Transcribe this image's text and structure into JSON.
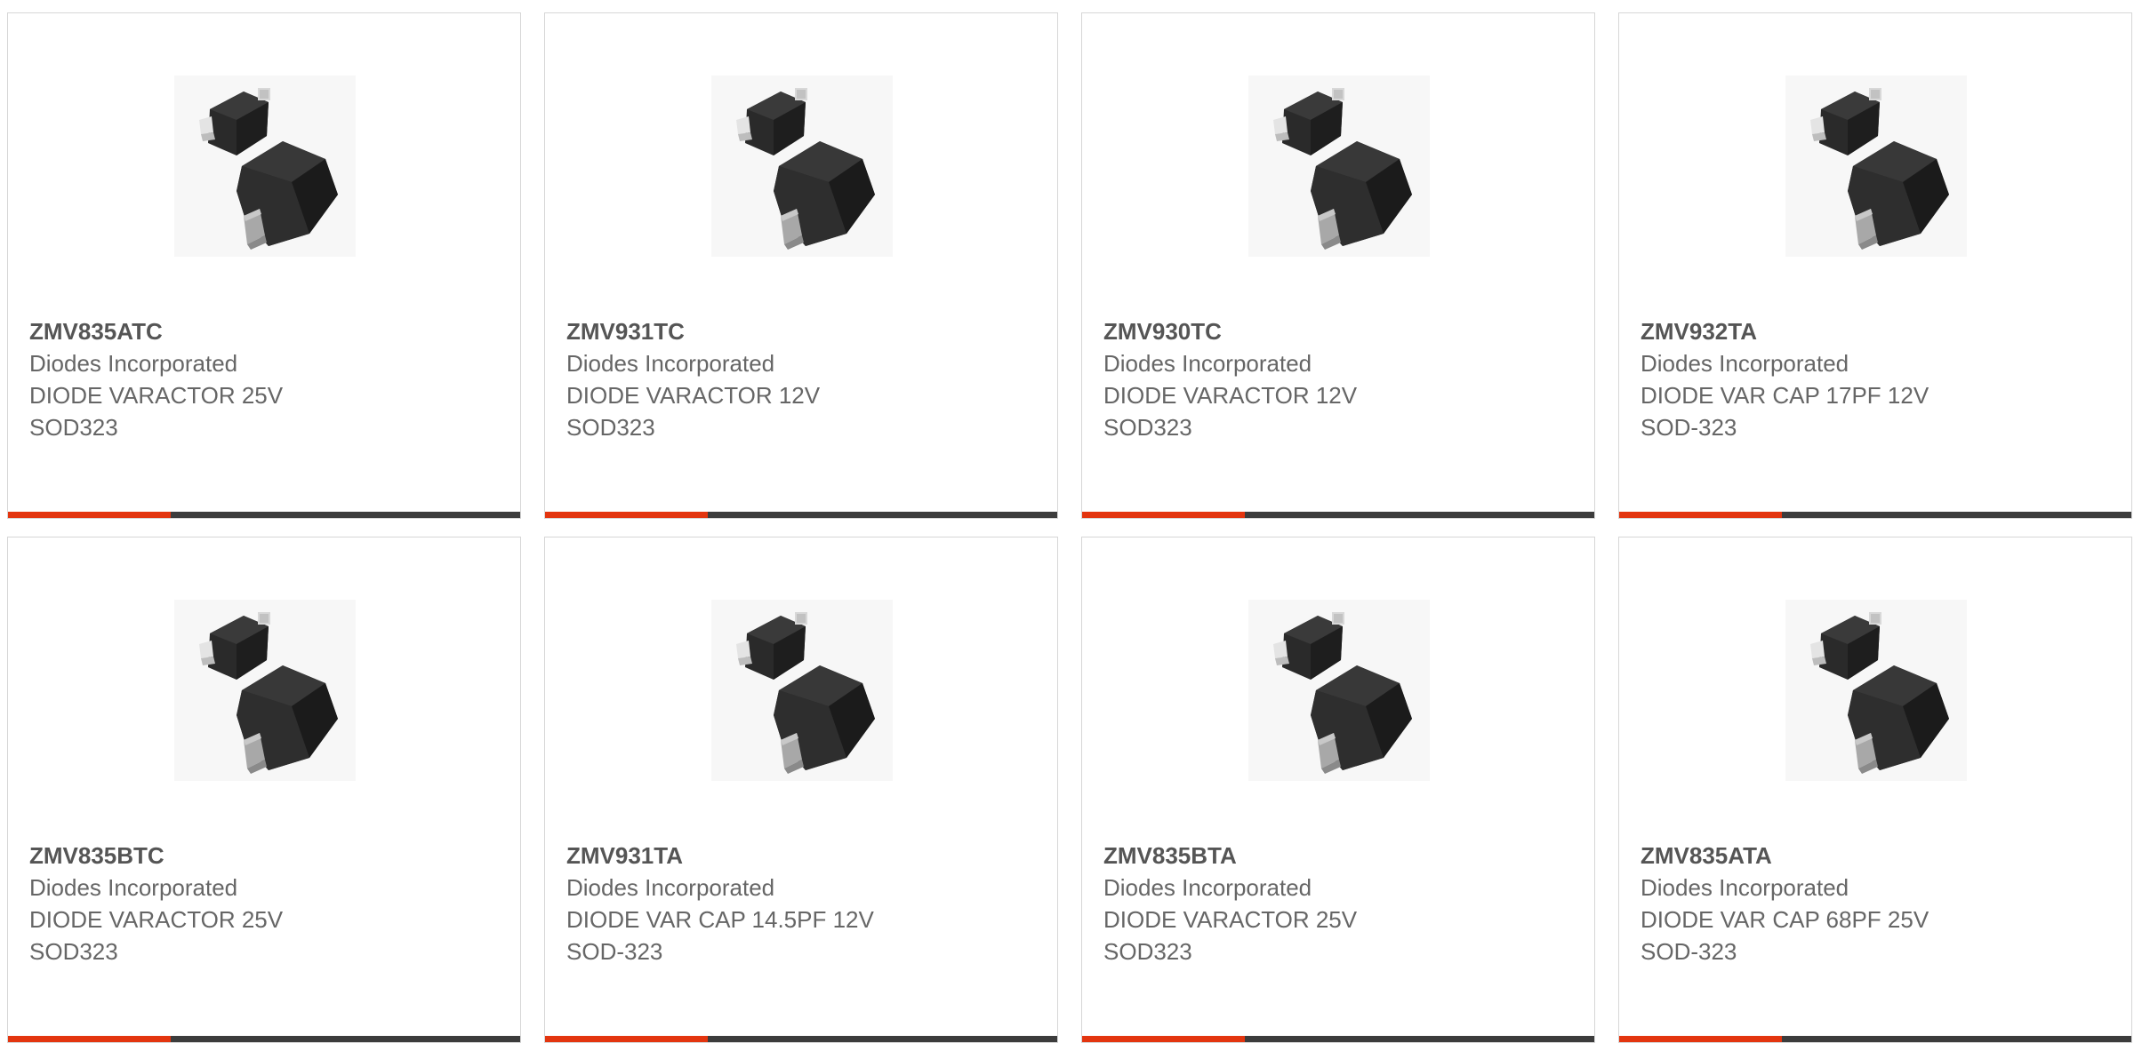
{
  "colors": {
    "accent": "#e3350f",
    "bar": "#3c3c3c",
    "border": "#d6d6d6",
    "text_bold": "#555555",
    "text": "#666666"
  },
  "products": [
    {
      "part_number": "ZMV835ATC",
      "manufacturer": "Diodes Incorporated",
      "description": "DIODE VARACTOR 25V",
      "package": "SOD323",
      "image_icon": "sod323-diode-package-image"
    },
    {
      "part_number": "ZMV931TC",
      "manufacturer": "Diodes Incorporated",
      "description": "DIODE VARACTOR 12V",
      "package": "SOD323",
      "image_icon": "sod323-diode-package-image"
    },
    {
      "part_number": "ZMV930TC",
      "manufacturer": "Diodes Incorporated",
      "description": "DIODE VARACTOR 12V",
      "package": "SOD323",
      "image_icon": "sod323-diode-package-image"
    },
    {
      "part_number": "ZMV932TA",
      "manufacturer": "Diodes Incorporated",
      "description": "DIODE VAR CAP 17PF 12V",
      "package": "SOD-323",
      "image_icon": "sod323-diode-package-image"
    },
    {
      "part_number": "ZMV835BTC",
      "manufacturer": "Diodes Incorporated",
      "description": "DIODE VARACTOR 25V",
      "package": "SOD323",
      "image_icon": "sod323-diode-package-image"
    },
    {
      "part_number": "ZMV931TA",
      "manufacturer": "Diodes Incorporated",
      "description": "DIODE VAR CAP 14.5PF 12V",
      "package": "SOD-323",
      "image_icon": "sod323-diode-package-image"
    },
    {
      "part_number": "ZMV835BTA",
      "manufacturer": "Diodes Incorporated",
      "description": "DIODE VARACTOR 25V",
      "package": "SOD323",
      "image_icon": "sod323-diode-package-image"
    },
    {
      "part_number": "ZMV835ATA",
      "manufacturer": "Diodes Incorporated",
      "description": "DIODE VAR CAP 68PF 25V",
      "package": "SOD-323",
      "image_icon": "sod323-diode-package-image"
    }
  ]
}
